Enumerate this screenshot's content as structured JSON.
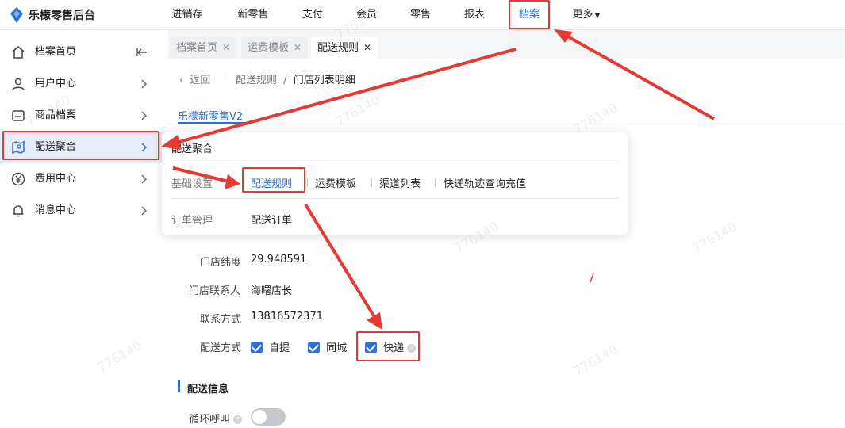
{
  "brand": {
    "name": "乐檬零售后台"
  },
  "nav": [
    {
      "label": "进销存",
      "active": false
    },
    {
      "label": "新零售",
      "active": false
    },
    {
      "label": "支付",
      "active": false
    },
    {
      "label": "会员",
      "active": false
    },
    {
      "label": "零售",
      "active": false
    },
    {
      "label": "报表",
      "active": false
    },
    {
      "label": "档案",
      "active": true
    },
    {
      "label": "更多",
      "active": false,
      "has_dropdown": true
    }
  ],
  "sidebar": {
    "items": [
      {
        "label": "档案首页",
        "icon": "home-icon"
      },
      {
        "label": "用户中心",
        "icon": "user-icon"
      },
      {
        "label": "商品档案",
        "icon": "product-icon"
      },
      {
        "label": "配送聚合",
        "icon": "map-icon",
        "active": true
      },
      {
        "label": "费用中心",
        "icon": "yen-icon"
      },
      {
        "label": "消息中心",
        "icon": "bell-icon"
      }
    ]
  },
  "tabs": [
    {
      "label": "档案首页",
      "active": false
    },
    {
      "label": "运费模板",
      "active": false
    },
    {
      "label": "配送规则",
      "active": true
    }
  ],
  "breadcrumb": {
    "back": "返回",
    "parent": "配送规则",
    "separator": "/",
    "current": "门店列表明细"
  },
  "store_tab": "乐檬新零售V2",
  "popup": {
    "title": "配送聚合",
    "rows": [
      {
        "group": "基础设置",
        "links": [
          {
            "label": "配送规则",
            "active": true
          },
          {
            "label": "运费模板"
          },
          {
            "label": "渠道列表"
          },
          {
            "label": "快递轨迹查询充值"
          }
        ]
      },
      {
        "group": "订单管理",
        "links": [
          {
            "label": "配送订单"
          }
        ]
      }
    ]
  },
  "store_info": {
    "latitude_label": "门店纬度",
    "latitude": "29.948591",
    "contact_label": "门店联系人",
    "contact": "海曙店长",
    "phone_label": "联系方式",
    "phone": "13816572371",
    "delivery_label": "配送方式",
    "delivery_options": [
      {
        "label": "自提",
        "checked": true
      },
      {
        "label": "同城",
        "checked": true
      },
      {
        "label": "快递",
        "checked": true,
        "help": true
      }
    ]
  },
  "delivery_info": {
    "section_title": "配送信息",
    "loop_call_label": "循环呼叫",
    "loop_call_on": false
  },
  "watermark": "776140",
  "colors": {
    "accent": "#2a6fd6",
    "highlight": "#e53935"
  }
}
